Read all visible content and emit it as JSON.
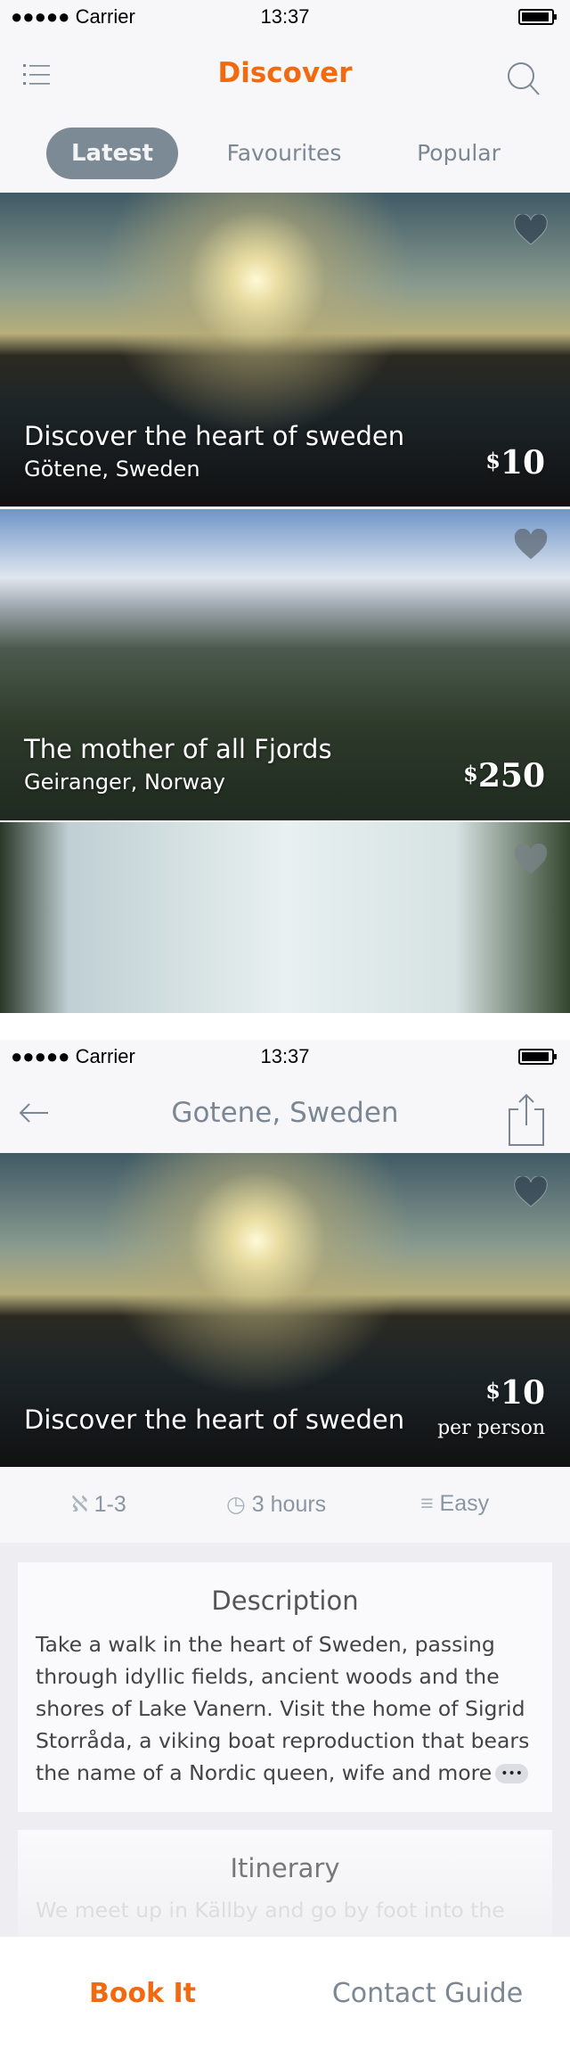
{
  "status": {
    "carrier": "Carrier",
    "time": "13:37"
  },
  "discover": {
    "title": "Discover",
    "menu_icon": "list-icon",
    "search_icon": "search-icon",
    "tabs": [
      {
        "label": "Latest",
        "active": true
      },
      {
        "label": "Favourites"
      },
      {
        "label": "Popular"
      }
    ],
    "cards": [
      {
        "title": "Discover the heart of sweden",
        "location": "Götene, Sweden",
        "currency": "$",
        "price": "10"
      },
      {
        "title": "The mother of all Fjords",
        "location": "Geiranger, Norway",
        "currency": "$",
        "price": "250"
      },
      {
        "title": "",
        "location": "",
        "price": ""
      }
    ]
  },
  "detail": {
    "title": "Gotene, Sweden",
    "card": {
      "title": "Discover the heart of sweden",
      "currency": "$",
      "price": "10",
      "per": "per person"
    },
    "info": {
      "group": "1-3",
      "duration": "3 hours",
      "difficulty": "Easy"
    },
    "description": {
      "heading": "Description",
      "text": "Take a walk in the heart of Sweden, passing through idyllic fields, ancient woods and the shores of Lake Vanern. Visit the home of Sigrid Storråda, a viking boat reproduction that bears the name of a Nordic queen, wife and more",
      "more": "•••"
    },
    "itinerary": {
      "heading": "Itinerary",
      "text": "We meet up in Källby and go by foot into the"
    },
    "book_label": "Book It",
    "contact_label": "Contact Guide"
  },
  "colors": {
    "accent": "#f26a10",
    "muted": "#7b8794",
    "pill": "#7c8a96"
  }
}
